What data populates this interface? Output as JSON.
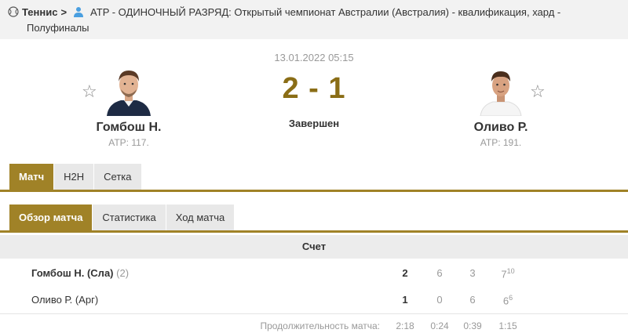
{
  "breadcrumb": {
    "sport": "Теннис",
    "arrow": ">",
    "tournament_line1": "ATP - ОДИНОЧНЫЙ РАЗРЯД: Открытый чемпионат Австралии (Австралия) - квалификация, хард -",
    "tournament_line2": "Полуфиналы"
  },
  "match": {
    "date": "13.01.2022 05:15",
    "score": "2 - 1",
    "status": "Завершен"
  },
  "home": {
    "name": "Гомбош Н.",
    "rank": "ATP: 117.",
    "favorite_icon": "☆"
  },
  "away": {
    "name": "Оливо Р.",
    "rank": "ATP: 191.",
    "favorite_icon": "☆"
  },
  "tabs_main": [
    "Матч",
    "H2H",
    "Сетка"
  ],
  "tabs_sub": [
    "Обзор матча",
    "Статистика",
    "Ход матча"
  ],
  "score_table": {
    "header": "Счет",
    "rows": [
      {
        "name": "Гомбош Н. (Сла)",
        "seed": "(2)",
        "total": "2",
        "s1": "6",
        "s2": "3",
        "s3": "7",
        "s3_tb": "10"
      },
      {
        "name": "Оливо Р. (Арг)",
        "seed": "",
        "total": "1",
        "s1": "0",
        "s2": "6",
        "s3": "6",
        "s3_tb": "6"
      }
    ],
    "duration_label": "Продолжительность матча:",
    "durations": [
      "2:18",
      "0:24",
      "0:39",
      "1:15"
    ]
  },
  "colors": {
    "accent": "#a08227",
    "score": "#8a6d16"
  }
}
